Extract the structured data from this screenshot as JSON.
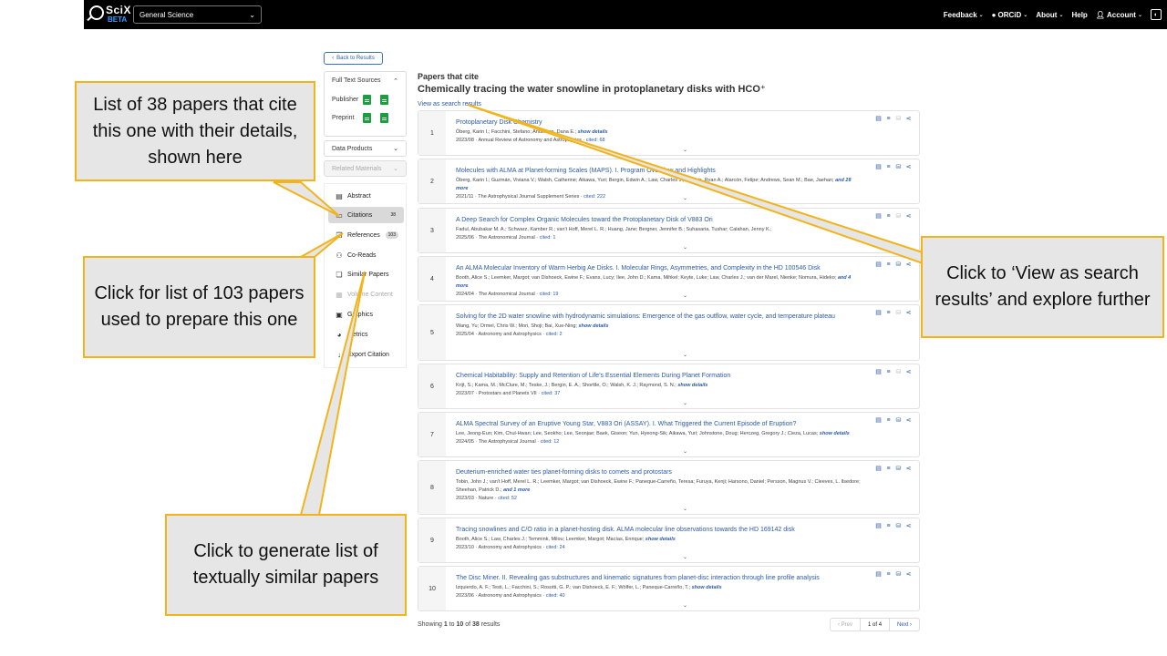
{
  "header": {
    "logo": "SciX",
    "logo_beta": "BETA",
    "discipline": "General Science",
    "nav": {
      "feedback": "Feedback",
      "orcid": "ORCiD",
      "about": "About",
      "help": "Help",
      "account": "Account"
    }
  },
  "sidebar": {
    "back": "Back to Results",
    "full_text_sources": "Full Text Sources",
    "publisher": "Publisher",
    "preprint": "Preprint",
    "data_products": "Data Products",
    "related_materials": "Related Materials",
    "menu": [
      {
        "label": "Abstract",
        "count": ""
      },
      {
        "label": "Citations",
        "count": "38"
      },
      {
        "label": "References",
        "count": "103"
      },
      {
        "label": "Co-Reads",
        "count": ""
      },
      {
        "label": "Similar Papers",
        "count": ""
      },
      {
        "label": "Volume Content",
        "count": ""
      },
      {
        "label": "Graphics",
        "count": ""
      },
      {
        "label": "Metrics",
        "count": ""
      },
      {
        "label": "Export Citation",
        "count": ""
      }
    ]
  },
  "main": {
    "subtitle": "Papers that cite",
    "title": "Chemically tracing the water snowline in protoplanetary disks with HCO⁺",
    "view_link": "View as search results",
    "results": [
      {
        "num": "1",
        "title": "Protoplanetary Disk Chemistry",
        "authors": "Öberg, Karin I.; Facchini, Stefano; Anderson, Dana E.;",
        "more": "show details",
        "date": "2023/08",
        "journal": "Annual Review of Astronomy and Astrophysics",
        "cited": "cited: 68"
      },
      {
        "num": "2",
        "title": "Molecules with ALMA at Planet-forming Scales (MAPS). I. Program Overview and Highlights",
        "authors": "Öberg, Karin I.; Guzmán, Viviana V.; Walsh, Catherine; Aikawa, Yuri; Bergin, Edwin A.; Law, Charles J.; Loomis, Ryan A.; Alarcón, Felipe; Andrews, Sean M.; Bae, Jaehan;",
        "more": "and 28 more",
        "date": "2021/11",
        "journal": "The Astrophysical Journal Supplement Series",
        "cited": "cited: 222"
      },
      {
        "num": "3",
        "title": "A Deep Search for Complex Organic Molecules toward the Protoplanetary Disk of V883 Ori",
        "authors": "Fadul, Abubakar M. A.; Schwarz, Kamber R.; van't Hoff, Merel L. R.; Huang, Jane; Bergner, Jennifer B.; Suhasaria, Tushar; Calahan, Jenny K.;",
        "more": "",
        "date": "2025/06",
        "journal": "The Astronomical Journal",
        "cited": "cited: 1"
      },
      {
        "num": "4",
        "title": "An ALMA Molecular Inventory of Warm Herbig Ae Disks. I. Molecular Rings, Asymmetries, and Complexity in the HD 100546 Disk",
        "authors": "Booth, Alice S.; Leemker, Margot; van Dishoeck, Ewine F.; Evans, Lucy; Ilee, John D.; Kama, Mihkel; Keyte, Luke; Law, Charles J.; van der Marel, Nienke; Nomura, Hideko;",
        "more": "and 4 more",
        "date": "2024/04",
        "journal": "The Astronomical Journal",
        "cited": "cited: 19"
      },
      {
        "num": "5",
        "title": "Solving for the 2D water snowline with hydrodynamic simulations: Emergence of the gas outflow, water cycle, and temperature plateau",
        "authors": "Wang, Yu; Ormel, Chris W.; Mori, Shoji; Bai, Xue-Ning;",
        "more": "show details",
        "date": "2025/04",
        "journal": "Astronomy and Astrophysics",
        "cited": "cited: 2"
      },
      {
        "num": "6",
        "title": "Chemical Habitability: Supply and Retention of Life's Essential Elements During Planet Formation",
        "authors": "Krijt, S.; Kama, M.; McClure, M.; Teske, J.; Bergin, E. A.; Shorttle, O.; Walsh, K. J.; Raymond, S. N.;",
        "more": "show details",
        "date": "2023/07",
        "journal": "Protostars and Planets VII",
        "cited": "cited: 37"
      },
      {
        "num": "7",
        "title": "ALMA Spectral Survey of an Eruptive Young Star, V883 Ori (ASSAY). I. What Triggered the Current Episode of Eruption?",
        "authors": "Lee, Jeong-Eun; Kim, Chul-Hwan; Lee, Seokho; Lee, Seonjae; Baek, Giseon; Yun, Hyeong-Sik; Aikawa, Yuri; Johnstone, Doug; Herczeg, Gregory J.; Cieza, Lucas;",
        "more": "show details",
        "date": "2024/05",
        "journal": "The Astrophysical Journal",
        "cited": "cited: 12"
      },
      {
        "num": "8",
        "title": "Deuterium-enriched water ties planet-forming disks to comets and protostars",
        "authors": "Tobin, John J.; van't Hoff, Merel L. R.; Leemker, Margot; van Dishoeck, Ewine F.; Paneque-Carreño, Teresa; Furuya, Kenji; Harsono, Daniel; Persson, Magnus V.; Cleeves, L. Ilsedore; Sheehan, Patrick D.;",
        "more": "and 1 more",
        "date": "2023/03",
        "journal": "Nature",
        "cited": "cited: 52"
      },
      {
        "num": "9",
        "title": "Tracing snowlines and C/O ratio in a planet-hosting disk. ALMA molecular line observations towards the HD 169142 disk",
        "authors": "Booth, Alice S.; Law, Charles J.; Temmink, Milou; Leemker, Margot; Macías, Enrique;",
        "more": "show details",
        "date": "2023/10",
        "journal": "Astronomy and Astrophysics",
        "cited": "cited: 24"
      },
      {
        "num": "10",
        "title": "The Disc Miner. II. Revealing gas substructures and kinematic signatures from planet-disc interaction through line profile analysis",
        "authors": "Izquierdo, A. F.; Testi, L.; Facchini, S.; Rosotti, G. P.; van Dishoeck, E. F.; Wölfer, L.; Paneque-Carreño, T.;",
        "more": "show details",
        "date": "2023/06",
        "journal": "Astronomy and Astrophysics",
        "cited": "cited: 40"
      }
    ],
    "showing_prefix": "Showing",
    "showing_from": "1",
    "showing_to_word": "to",
    "showing_to": "10",
    "showing_of_word": "of",
    "showing_total": "38",
    "showing_suffix": "results",
    "pager": {
      "prev": "Prev",
      "page": "1 of 4",
      "next": "Next"
    }
  },
  "callouts": {
    "citations": "List of 38 papers that cite this one with their details, shown here",
    "references": "Click for list of 103 papers used to prepare this one",
    "similar": "Click to generate list of textually similar papers",
    "view_search": "Click to ‘View as search results’ and explore further"
  },
  "colors": {
    "accent": "#2b5aa8",
    "callout_border": "#f2b418",
    "callout_fill": "#e6e6e6",
    "pdf_green": "#1a9e3f"
  }
}
